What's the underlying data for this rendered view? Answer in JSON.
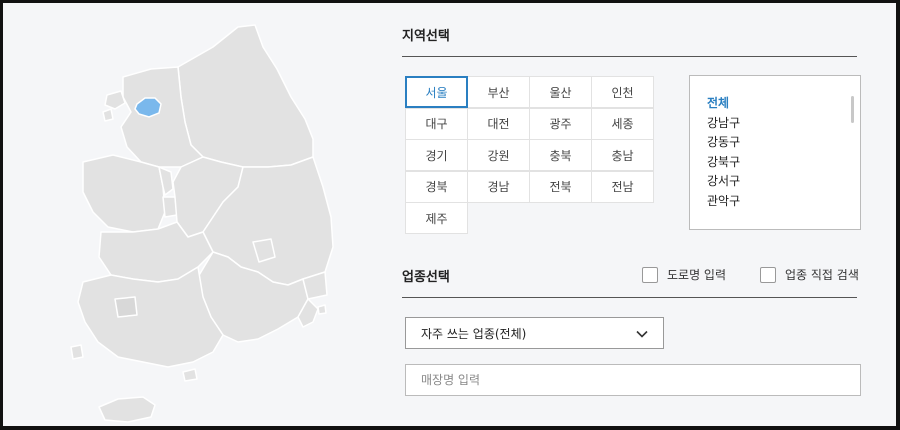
{
  "region_section": {
    "title": "지역선택"
  },
  "regions": [
    {
      "label": "서울",
      "selected": true
    },
    {
      "label": "부산"
    },
    {
      "label": "울산"
    },
    {
      "label": "인천"
    },
    {
      "label": "대구"
    },
    {
      "label": "대전"
    },
    {
      "label": "광주"
    },
    {
      "label": "세종"
    },
    {
      "label": "경기"
    },
    {
      "label": "강원"
    },
    {
      "label": "충북"
    },
    {
      "label": "충남"
    },
    {
      "label": "경북"
    },
    {
      "label": "경남"
    },
    {
      "label": "전북"
    },
    {
      "label": "전남"
    },
    {
      "label": "제주"
    }
  ],
  "districts": [
    {
      "label": "전체",
      "active": true
    },
    {
      "label": "강남구"
    },
    {
      "label": "강동구"
    },
    {
      "label": "강북구"
    },
    {
      "label": "강서구"
    },
    {
      "label": "관악구"
    }
  ],
  "business_section": {
    "title": "업종선택",
    "road_name_label": "도로명 입력",
    "direct_search_label": "업종 직접 검색",
    "select_value": "자주 쓰는 업종(전체)",
    "store_placeholder": "매장명 입력"
  },
  "colors": {
    "accent": "#2a7fc1",
    "map_fill": "#e2e2e2",
    "map_highlight": "#7ab8ec"
  },
  "icons": {
    "dropdown": "chevron-down-icon"
  }
}
